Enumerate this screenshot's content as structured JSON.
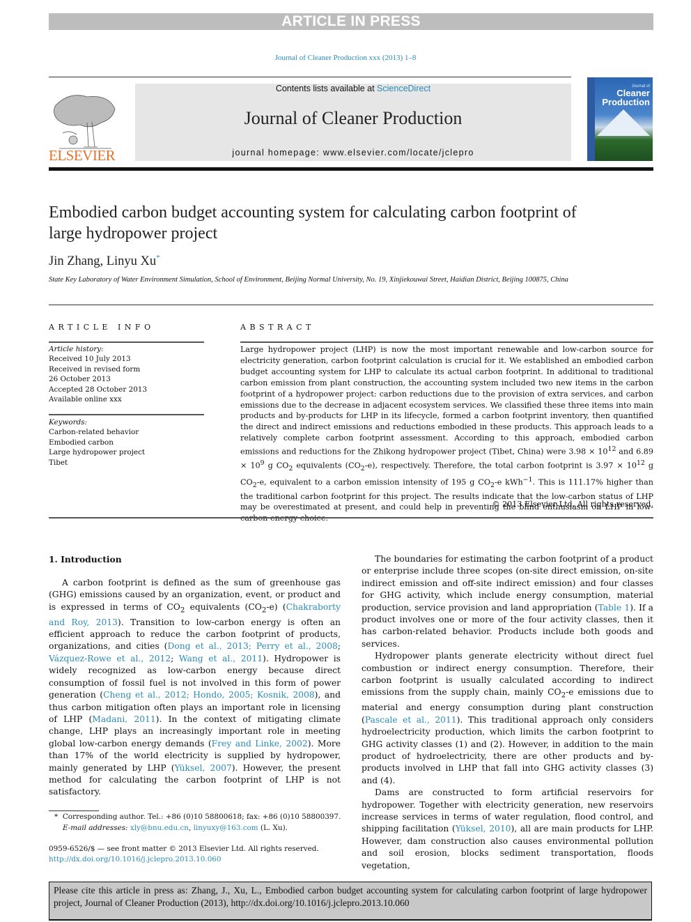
{
  "banner": "ARTICLE IN PRESS",
  "journal_ref": "Journal of Cleaner Production xxx (2013) 1–8",
  "masthead": {
    "contents_prefix": "Contents lists available at ",
    "contents_link": "ScienceDirect",
    "journal_title": "Journal of Cleaner Production",
    "homepage": "journal homepage: www.elsevier.com/locate/jclepro",
    "publisher": "ELSEVIER",
    "cover_small": "Journal of",
    "cover_title_1": "Cleaner",
    "cover_title_2": "Production"
  },
  "article": {
    "title": "Embodied carbon budget accounting system for calculating carbon footprint of large hydropower project",
    "authors": "Jin Zhang, Linyu Xu",
    "author_mark": "*",
    "affiliation": "State Key Laboratory of Water Environment Simulation, School of Environment, Beijing Normal University, No. 19, Xinjiekouwai Street, Haidian District, Beijing 100875, China"
  },
  "article_info": {
    "heading": "ARTICLE INFO",
    "history_label": "Article history:",
    "history": [
      "Received 10 July 2013",
      "Received in revised form",
      "26 October 2013",
      "Accepted 28 October 2013",
      "Available online xxx"
    ],
    "keywords_label": "Keywords:",
    "keywords": [
      "Carbon-related behavior",
      "Embodied carbon",
      "Large hydropower project",
      "Tibet"
    ]
  },
  "abstract": {
    "heading": "ABSTRACT",
    "p1": "Large hydropower project (LHP) is now the most important renewable and low-carbon source for electricity generation, carbon footprint calculation is crucial for it. We established an embodied carbon budget accounting system for LHP to calculate its actual carbon footprint. In additional to traditional carbon emission from plant construction, the accounting system included two new items in the carbon footprint of a hydropower project: carbon reductions due to the provision of extra services, and carbon emissions due to the decrease in adjacent ecosystem services. We classified these three items into main products and by-products for LHP in its lifecycle, formed a carbon footprint inventory, then quantified the direct and indirect emissions and reductions embodied in these products. This approach leads to a relatively complete carbon footprint assessment. According to this approach, embodied carbon emissions and reductions for the Zhikong hydropower project (Tibet, China) were 3.98 × 10",
    "exp1": "12",
    "p2": " and 6.89 × 10",
    "exp2": "9",
    "p3": " g CO",
    "sub1": "2",
    "p4": " equivalents (CO",
    "sub2": "2",
    "p5": "-e), respectively. Therefore, the total carbon footprint is 3.97 × 10",
    "exp3": "12",
    "p6": " g CO",
    "sub3": "2",
    "p7": "-e, equivalent to a carbon emission intensity of 195 g CO",
    "sub4": "2",
    "p8": "-e kWh",
    "exp4": "−1",
    "p9": ". This is 111.17% higher than the traditional carbon footprint for this project. The results indicate that the low-carbon status of LHP may be overestimated at present, and could help in preventing the blind enthusiasm on LHP in low-carbon energy choice.",
    "copyright": "© 2013 Elsevier Ltd. All rights reserved."
  },
  "intro": {
    "heading": "1.  Introduction",
    "left": {
      "t1": "A carbon footprint is defined as the sum of greenhouse gas (GHG) emissions caused by an organization, event, or product and is expressed in terms of CO",
      "s1": "2",
      "t2": " equivalents (CO",
      "s2": "2",
      "t3": "-e) (",
      "l1": "Chakraborty and Roy, 2013",
      "t4": "). Transition to low-carbon energy is often an efficient approach to reduce the carbon footprint of products, organizations, and cities (",
      "l2": "Dong et al., 2013; Perry et al., 2008",
      "t5": "; ",
      "l3": "Vázquez-Rowe et al., 2012",
      "t6": "; ",
      "l4": "Wang et al., 2011",
      "t7": "). Hydropower is widely recognized as low-carbon energy because direct consumption of fossil fuel is not involved in this form of power generation (",
      "l5": "Cheng et al., 2012; Hondo, 2005; Kosnik, 2008",
      "t8": "), and thus carbon mitigation often plays an important role in licensing of LHP (",
      "l6": "Madani, 2011",
      "t9": "). In the context of mitigating climate change, LHP plays an increasingly important role in meeting global low-carbon energy demands (",
      "l7": "Frey and Linke, 2002",
      "t10": "). More than 17% of the world electricity is supplied by hydropower, mainly generated by LHP (",
      "l8": "Yüksel, 2007",
      "t11": "). However, the present method for calculating the carbon footprint of LHP is not satisfactory."
    },
    "right": {
      "p1a": "The boundaries for estimating the carbon footprint of a product or enterprise include three scopes (on-site direct emission, on-site indirect emission and off-site indirect emission) and four classes for GHG activity, which include energy consumption, material production, service provision and land appropriation (",
      "p1l": "Table 1",
      "p1b": "). If a product involves one or more of the four activity classes, then it has carbon-related behavior. Products include both goods and services.",
      "p2a": "Hydropower plants generate electricity without direct fuel combustion or indirect energy consumption. Therefore, their carbon footprint is usually calculated according to indirect emissions from the supply chain, mainly CO",
      "p2s": "2",
      "p2b": "-e emissions due to material and energy consumption during plant construction (",
      "p2l": "Pascale et al., 2011",
      "p2c": "). This traditional approach only considers hydroelectricity production, which limits the carbon footprint to GHG activity classes (1) and (2). However, in addition to the main product of hydroelectricity, there are other products and by-products involved in LHP that fall into GHG activity classes (3) and (4).",
      "p3a": "Dams are constructed to form artificial reservoirs for hydropower. Together with electricity generation, new reservoirs increase services in terms of water regulation, flood control, and shipping facilitation (",
      "p3l": "Yüksel, 2010",
      "p3b": "), all are main products for LHP. However, dam construction also causes environmental pollution and soil erosion, blocks sediment transportation, floods vegetation,"
    }
  },
  "footnote": {
    "mark": "*",
    "line1": "Corresponding author. Tel.: +86 (0)10 58800618; fax: +86 (0)10 58800397.",
    "email_label": "E-mail addresses:",
    "email1": "xly@bnu.edu.cn",
    "sep": ", ",
    "email2": "linyuxy@163.com",
    "email_suffix": " (L. Xu)."
  },
  "front_matter": {
    "issn": "0959-6526/$ — see front matter © 2013 Elsevier Ltd. All rights reserved.",
    "doi": "http://dx.doi.org/10.1016/j.jclepro.2013.10.060"
  },
  "citation_box": "Please cite this article in press as: Zhang, J., Xu, L., Embodied carbon budget accounting system for calculating carbon footprint of large hydropower project, Journal of Cleaner Production (2013), http://dx.doi.org/10.1016/j.jclepro.2013.10.060"
}
